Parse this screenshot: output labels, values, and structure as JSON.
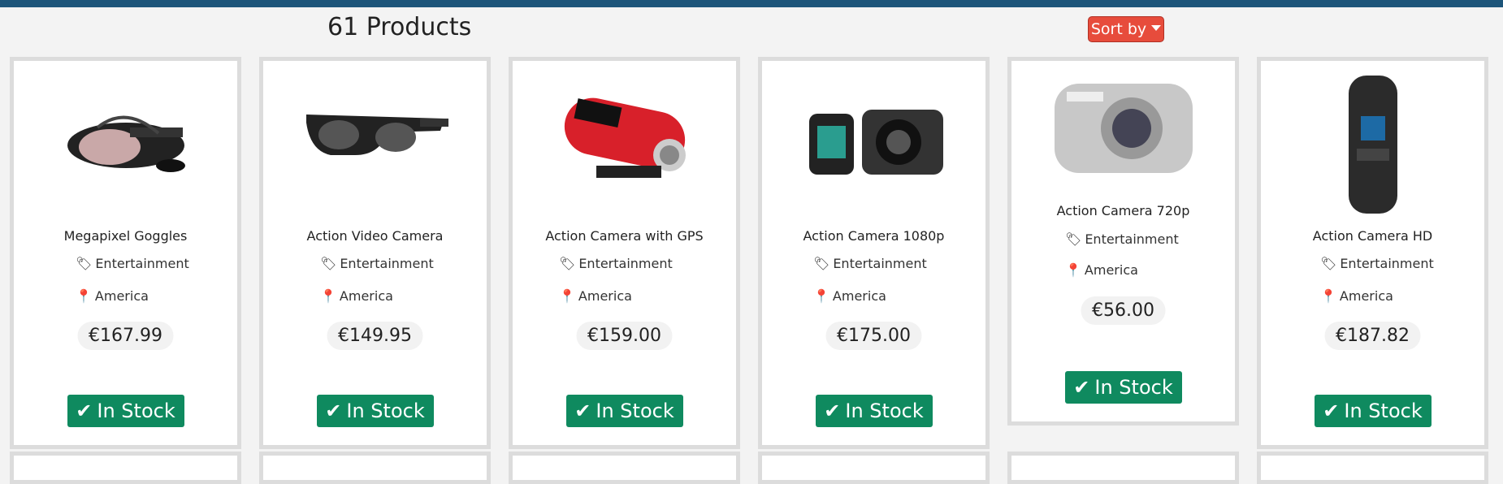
{
  "header": {
    "products_count": "61 Products",
    "sort_label": "Sort by"
  },
  "products": [
    {
      "name": "Megapixel Goggles",
      "category": "Entertainment",
      "location": "America",
      "price": "€167.99",
      "stock": "In Stock"
    },
    {
      "name": "Action Video Camera",
      "category": "Entertainment",
      "location": "America",
      "price": "€149.95",
      "stock": "In Stock"
    },
    {
      "name": "Action Camera with GPS",
      "category": "Entertainment",
      "location": "America",
      "price": "€159.00",
      "stock": "In Stock"
    },
    {
      "name": "Action Camera 1080p",
      "category": "Entertainment",
      "location": "America",
      "price": "€175.00",
      "stock": "In Stock"
    },
    {
      "name": "Action Camera 720p",
      "category": "Entertainment",
      "location": "America",
      "price": "€56.00",
      "stock": "In Stock"
    },
    {
      "name": "Action Camera HD",
      "category": "Entertainment",
      "location": "America",
      "price": "€187.82",
      "stock": "In Stock"
    }
  ],
  "icons": {
    "category": "tags-icon",
    "location": "map-pin-icon",
    "stock": "check-icon"
  },
  "colors": {
    "topbar": "#1d557a",
    "sort_button": "#e74c3c",
    "in_stock": "#0f8a5f"
  }
}
